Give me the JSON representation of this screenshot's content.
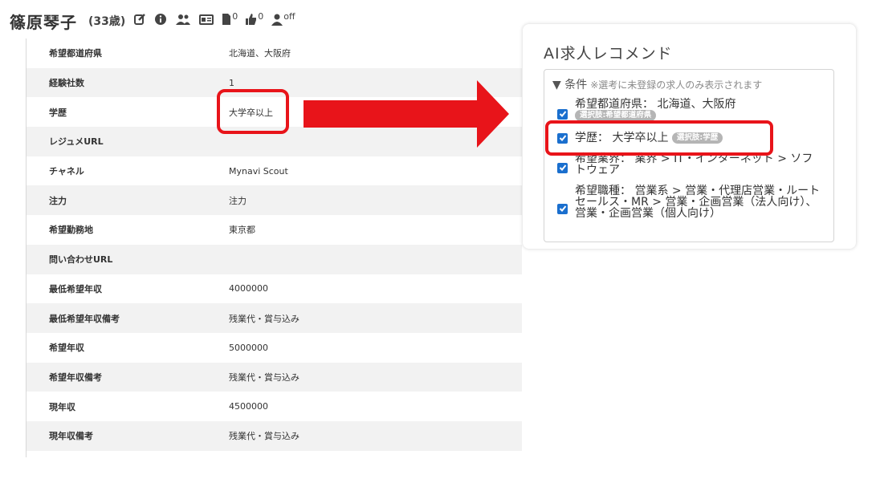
{
  "header": {
    "name": "篠原琴子",
    "age": "(33歳)",
    "icons": [
      {
        "name": "edit-icon",
        "sup": ""
      },
      {
        "name": "info-icon",
        "sup": ""
      },
      {
        "name": "users-icon",
        "sup": ""
      },
      {
        "name": "id-card-icon",
        "sup": ""
      },
      {
        "name": "document-icon",
        "sup": "0"
      },
      {
        "name": "thumbs-up-icon",
        "sup": "0"
      },
      {
        "name": "person-status-icon",
        "sup": "off"
      }
    ]
  },
  "details": [
    {
      "label": "希望都道府県",
      "value": "北海道、大阪府"
    },
    {
      "label": "経験社数",
      "value": "1"
    },
    {
      "label": "学歴",
      "value": "大学卒以上"
    },
    {
      "label": "レジュメURL",
      "value": ""
    },
    {
      "label": "チャネル",
      "value": "Mynavi Scout"
    },
    {
      "label": "注力",
      "value": "注力"
    },
    {
      "label": "希望勤務地",
      "value": "東京都"
    },
    {
      "label": "問い合わせURL",
      "value": ""
    },
    {
      "label": "最低希望年収",
      "value": "4000000"
    },
    {
      "label": "最低希望年収備考",
      "value": "残業代・賞与込み"
    },
    {
      "label": "希望年収",
      "value": "5000000"
    },
    {
      "label": "希望年収備考",
      "value": "残業代・賞与込み"
    },
    {
      "label": "現年収",
      "value": "4500000"
    },
    {
      "label": "現年収備考",
      "value": "残業代・賞与込み"
    }
  ],
  "recommend": {
    "title": "AI求人レコメンド",
    "condition_label": "▼ 条件",
    "condition_note": "※選考に未登録の求人のみ表示されます",
    "conditions": [
      {
        "text": "希望都道府県： 北海道、大阪府",
        "tag": "選択肢:希望都道府県",
        "checked": true
      },
      {
        "text": "学歴： 大学卒以上",
        "tag": "選択肢:学歴",
        "checked": true
      },
      {
        "text": "希望業界： 業界 > IT・インターネット > ソフトウェア",
        "tag": "",
        "checked": true
      },
      {
        "text": "希望職種： 営業系 > 営業・代理店営業・ルートセールス・MR > 営業・企画営業（法人向け）、営業・企画営業（個人向け）",
        "tag": "",
        "checked": true
      }
    ]
  },
  "colors": {
    "highlight": "#e8141a",
    "checkbox": "#1a6fce",
    "tag": "#b5b5b5"
  }
}
